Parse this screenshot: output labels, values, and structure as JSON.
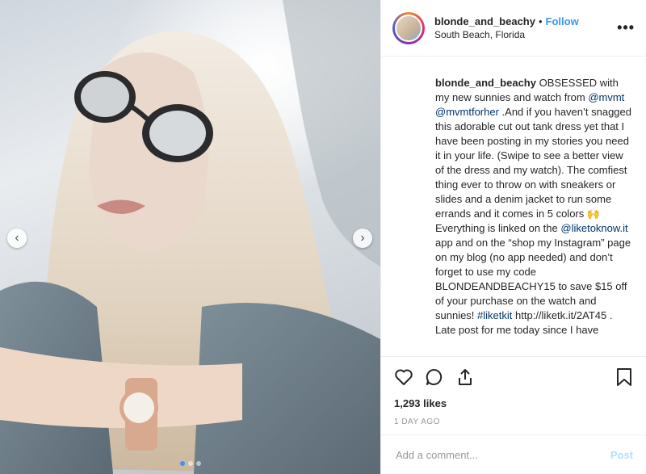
{
  "header": {
    "username": "blonde_and_beachy",
    "separator": "•",
    "follow_label": "Follow",
    "location": "South Beach, Florida",
    "more_label": "•••"
  },
  "media": {
    "prev_label": "‹",
    "next_label": "›",
    "slide_count": 3,
    "active_slide": 1
  },
  "caption": {
    "username": "blonde_and_beachy",
    "t1": " OBSESSED with my new sunnies and watch from ",
    "mention1": "@mvmt",
    "t2": " ",
    "mention2": "@mvmtforher",
    "t3": " .And if you haven’t snagged this adorable cut out tank dress yet that I have been posting in my stories you need it in your life. (Swipe to see a better view of the dress and my watch). The comfiest thing ever to throw on with sneakers or slides and a denim jacket to run some errands and it comes in 5 colors 🙌 Everything is linked on the ",
    "mention3": "@liketoknow.it",
    "t4": " app and on the “shop my Instagram” page on my blog (no app needed) and don’t forget to use my code BLONDEANDBEACHY15 to save $15 off of your purchase on the watch and sunnies! ",
    "hashtag": "#liketkit",
    "t5": " http://liketk.it/2AT45 .",
    "t6": "Late post for me today since I have"
  },
  "actions": {
    "likes": "1,293 likes",
    "date": "1 DAY AGO"
  },
  "comment": {
    "placeholder": "Add a comment...",
    "post_label": "Post"
  },
  "colors": {
    "accent": "#3897f0",
    "link": "#003569",
    "muted": "#999999",
    "post_disabled": "#b2dffc"
  }
}
